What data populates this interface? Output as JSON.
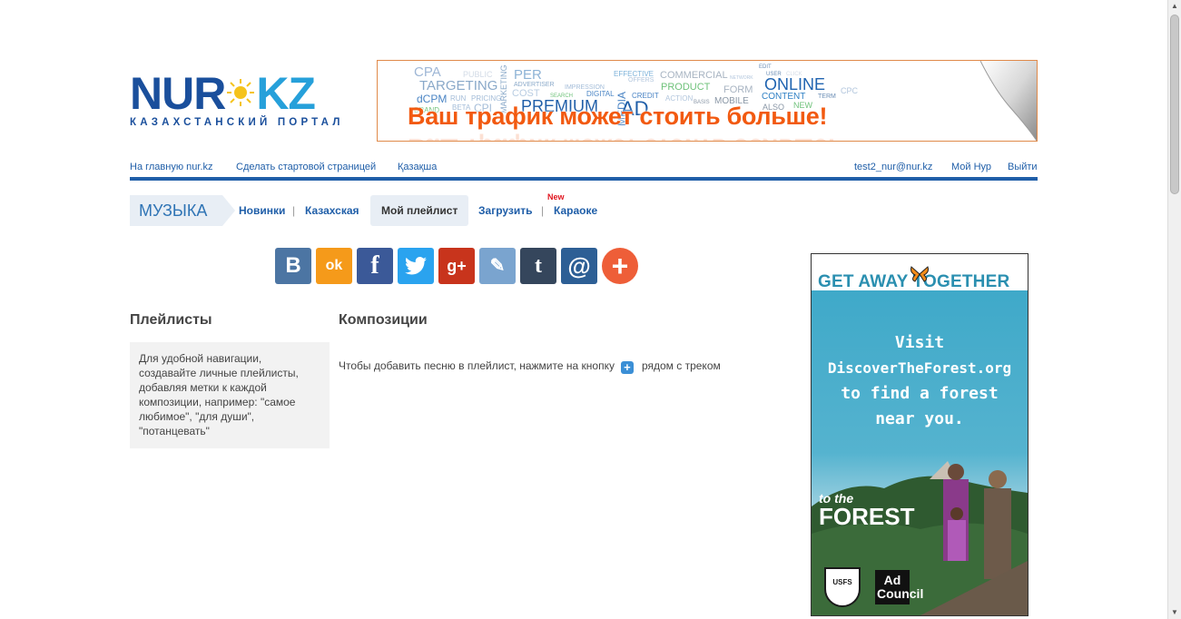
{
  "logo": {
    "main_left": "NUR",
    "main_right": "KZ",
    "subtitle": "КАЗАХСТАНСКИЙ ПОРТАЛ"
  },
  "banner": {
    "headline": "Ваш трафик может стоить больше!",
    "cloud_words": [
      "CPA",
      "PUBLIC",
      "PER",
      "TARGETING",
      "ADVERTISER",
      "COST",
      "dCPM",
      "RUN",
      "PRICING",
      "PREMIUM",
      "EFFECTIVE",
      "OFFERS",
      "COMMERCIAL",
      "PRODUCT",
      "CONTENT",
      "ONLINE",
      "FORM",
      "MOBILE",
      "CPC",
      "EDIT",
      "USER",
      "CLICK",
      "NETWORK",
      "TERM",
      "DIGITAL",
      "IMPRESSION",
      "CREDIT",
      "ACTION",
      "SEARCH",
      "MARKETING",
      "MEDIA",
      "AD",
      "ALSO",
      "NEW",
      "BASIS",
      "CPI",
      "BRAND",
      "BETA"
    ]
  },
  "topnav": {
    "home": "На главную nur.kz",
    "make_start": "Сделать стартовой страницей",
    "kazakh": "Қазақша",
    "user_email": "test2_nur@nur.kz",
    "my_nur": "Мой Нур",
    "logout": "Выйти"
  },
  "music_nav": {
    "title": "МУЗЫКА",
    "items": [
      {
        "label": "Новинки"
      },
      {
        "label": "Казахская"
      },
      {
        "label": "Мой плейлист"
      },
      {
        "label": "Загрузить"
      },
      {
        "label": "Караоке"
      }
    ],
    "new_badge": "New",
    "separator": "|"
  },
  "share": {
    "buttons": [
      {
        "name": "vkontakte",
        "glyph": "В",
        "color": "#4c75a3"
      },
      {
        "name": "odnoklassniki",
        "glyph": "ok",
        "color": "#f59a1a"
      },
      {
        "name": "facebook",
        "glyph": "f",
        "color": "#3b5998"
      },
      {
        "name": "twitter",
        "glyph": "t",
        "color": "#2aa3ef"
      },
      {
        "name": "google-plus",
        "glyph": "g+",
        "color": "#c8341c"
      },
      {
        "name": "livejournal",
        "glyph": "✎",
        "color": "#7aa4cf"
      },
      {
        "name": "tumblr",
        "glyph": "t",
        "color": "#35465c"
      },
      {
        "name": "mail-ru",
        "glyph": "@",
        "color": "#2d5f95"
      },
      {
        "name": "more",
        "glyph": "+",
        "color": "#ee5e38"
      }
    ]
  },
  "sidebar": {
    "title": "Плейлисты",
    "hint": "Для удобной навигации, создавайте личные плейлисты, добавляя метки к каждой композиции, например: \"самое любимое\", \"для души\", \"потанцевать\""
  },
  "main": {
    "title": "Композиции",
    "hint_before": "Чтобы добавить песню в плейлист, нажмите на кнопку",
    "hint_after": "рядом с треком",
    "plus_glyph": "+"
  },
  "side_ad": {
    "headline": "GET AWAY TOGETHER",
    "message_lines": [
      "Visit",
      "DiscoverTheForest.org",
      "to find a forest",
      "near you."
    ],
    "to_the": "to the",
    "forest": "FOREST",
    "shield_text": "USFS",
    "ad_council": "Ad Council"
  }
}
